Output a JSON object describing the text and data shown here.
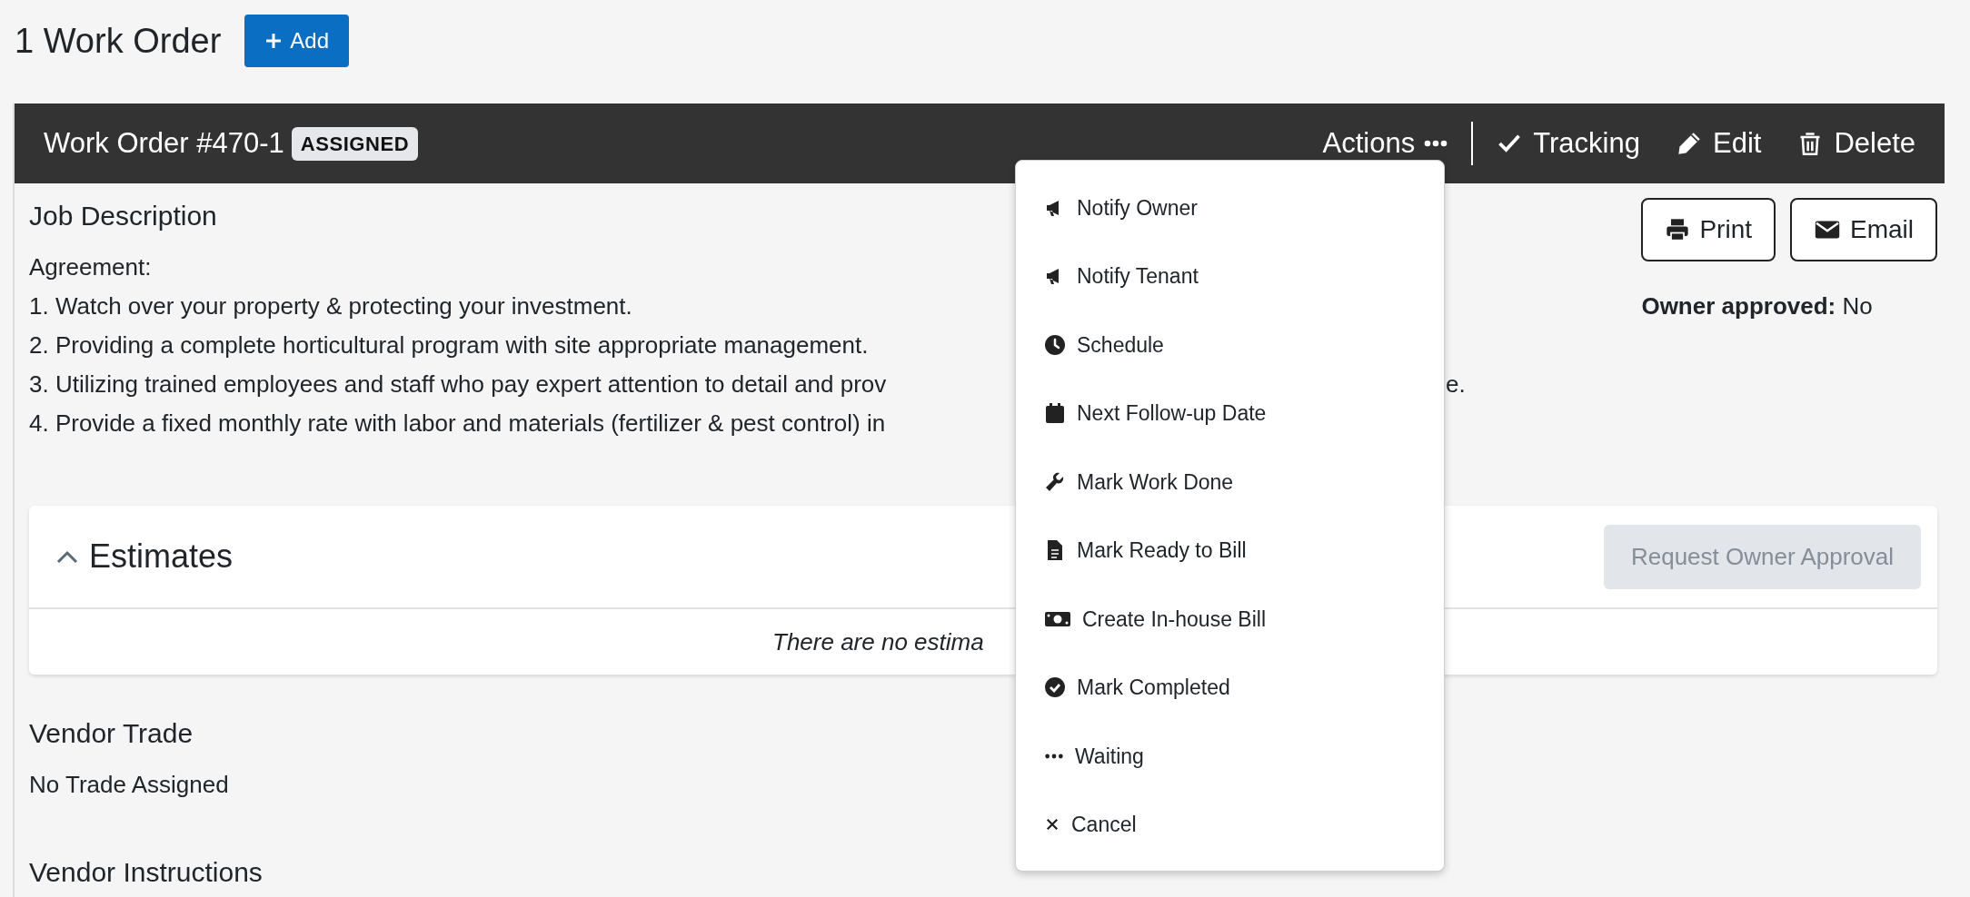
{
  "page": {
    "title": "1 Work Order",
    "add_button": "Add"
  },
  "work_order": {
    "title": "Work Order #470-1",
    "status": "ASSIGNED",
    "actions": "Actions",
    "toolbar": [
      {
        "kind": "tracking",
        "label": "Tracking"
      },
      {
        "kind": "edit",
        "label": "Edit"
      },
      {
        "kind": "delete",
        "label": "Delete"
      }
    ]
  },
  "actions_menu": [
    {
      "kind": "notify",
      "label": "Notify Owner"
    },
    {
      "kind": "notify",
      "label": "Notify Tenant"
    },
    {
      "kind": "schedule",
      "label": "Schedule"
    },
    {
      "kind": "calendar",
      "label": "Next Follow-up Date"
    },
    {
      "kind": "wrench",
      "label": "Mark Work Done"
    },
    {
      "kind": "file",
      "label": "Mark Ready to Bill"
    },
    {
      "kind": "money",
      "label": "Create In-house Bill"
    },
    {
      "kind": "complete",
      "label": "Mark Completed"
    },
    {
      "kind": "waiting",
      "label": "Waiting"
    },
    {
      "kind": "cancel",
      "label": "Cancel"
    }
  ],
  "job_description": {
    "heading": "Job Description",
    "lines": [
      {
        "text": "Agreement:"
      },
      {
        "text": "1. Watch over your property & protecting your investment."
      },
      {
        "text": "2. Providing a complete horticultural program with site appropriate management."
      },
      {
        "text": "3. Utilizing trained employees and staff who pay expert attention to detail and prov",
        "tail": "e."
      },
      {
        "text": "4. Provide a fixed monthly rate with labor and materials (fertilizer & pest control) in"
      }
    ]
  },
  "document_buttons": [
    {
      "kind": "print",
      "label": "Print"
    },
    {
      "kind": "email",
      "label": "Email"
    }
  ],
  "owner_approved": {
    "label": "Owner approved:",
    "value": "No"
  },
  "estimates": {
    "title": "Estimates",
    "expanded": true,
    "button": {
      "label": "Request Owner Approval",
      "disabled": true
    },
    "empty_message": "There are no estima"
  },
  "vendor_trade": {
    "heading": "Vendor Trade",
    "value": "No Trade Assigned"
  },
  "vendor_instructions": {
    "heading": "Vendor Instructions"
  }
}
